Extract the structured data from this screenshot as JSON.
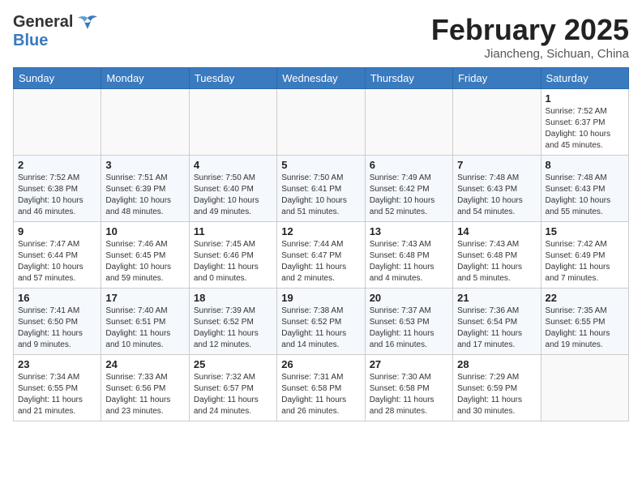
{
  "header": {
    "logo_general": "General",
    "logo_blue": "Blue",
    "month_title": "February 2025",
    "subtitle": "Jiancheng, Sichuan, China"
  },
  "days_of_week": [
    "Sunday",
    "Monday",
    "Tuesday",
    "Wednesday",
    "Thursday",
    "Friday",
    "Saturday"
  ],
  "weeks": [
    [
      {
        "day": "",
        "info": ""
      },
      {
        "day": "",
        "info": ""
      },
      {
        "day": "",
        "info": ""
      },
      {
        "day": "",
        "info": ""
      },
      {
        "day": "",
        "info": ""
      },
      {
        "day": "",
        "info": ""
      },
      {
        "day": "1",
        "info": "Sunrise: 7:52 AM\nSunset: 6:37 PM\nDaylight: 10 hours and 45 minutes."
      }
    ],
    [
      {
        "day": "2",
        "info": "Sunrise: 7:52 AM\nSunset: 6:38 PM\nDaylight: 10 hours and 46 minutes."
      },
      {
        "day": "3",
        "info": "Sunrise: 7:51 AM\nSunset: 6:39 PM\nDaylight: 10 hours and 48 minutes."
      },
      {
        "day": "4",
        "info": "Sunrise: 7:50 AM\nSunset: 6:40 PM\nDaylight: 10 hours and 49 minutes."
      },
      {
        "day": "5",
        "info": "Sunrise: 7:50 AM\nSunset: 6:41 PM\nDaylight: 10 hours and 51 minutes."
      },
      {
        "day": "6",
        "info": "Sunrise: 7:49 AM\nSunset: 6:42 PM\nDaylight: 10 hours and 52 minutes."
      },
      {
        "day": "7",
        "info": "Sunrise: 7:48 AM\nSunset: 6:43 PM\nDaylight: 10 hours and 54 minutes."
      },
      {
        "day": "8",
        "info": "Sunrise: 7:48 AM\nSunset: 6:43 PM\nDaylight: 10 hours and 55 minutes."
      }
    ],
    [
      {
        "day": "9",
        "info": "Sunrise: 7:47 AM\nSunset: 6:44 PM\nDaylight: 10 hours and 57 minutes."
      },
      {
        "day": "10",
        "info": "Sunrise: 7:46 AM\nSunset: 6:45 PM\nDaylight: 10 hours and 59 minutes."
      },
      {
        "day": "11",
        "info": "Sunrise: 7:45 AM\nSunset: 6:46 PM\nDaylight: 11 hours and 0 minutes."
      },
      {
        "day": "12",
        "info": "Sunrise: 7:44 AM\nSunset: 6:47 PM\nDaylight: 11 hours and 2 minutes."
      },
      {
        "day": "13",
        "info": "Sunrise: 7:43 AM\nSunset: 6:48 PM\nDaylight: 11 hours and 4 minutes."
      },
      {
        "day": "14",
        "info": "Sunrise: 7:43 AM\nSunset: 6:48 PM\nDaylight: 11 hours and 5 minutes."
      },
      {
        "day": "15",
        "info": "Sunrise: 7:42 AM\nSunset: 6:49 PM\nDaylight: 11 hours and 7 minutes."
      }
    ],
    [
      {
        "day": "16",
        "info": "Sunrise: 7:41 AM\nSunset: 6:50 PM\nDaylight: 11 hours and 9 minutes."
      },
      {
        "day": "17",
        "info": "Sunrise: 7:40 AM\nSunset: 6:51 PM\nDaylight: 11 hours and 10 minutes."
      },
      {
        "day": "18",
        "info": "Sunrise: 7:39 AM\nSunset: 6:52 PM\nDaylight: 11 hours and 12 minutes."
      },
      {
        "day": "19",
        "info": "Sunrise: 7:38 AM\nSunset: 6:52 PM\nDaylight: 11 hours and 14 minutes."
      },
      {
        "day": "20",
        "info": "Sunrise: 7:37 AM\nSunset: 6:53 PM\nDaylight: 11 hours and 16 minutes."
      },
      {
        "day": "21",
        "info": "Sunrise: 7:36 AM\nSunset: 6:54 PM\nDaylight: 11 hours and 17 minutes."
      },
      {
        "day": "22",
        "info": "Sunrise: 7:35 AM\nSunset: 6:55 PM\nDaylight: 11 hours and 19 minutes."
      }
    ],
    [
      {
        "day": "23",
        "info": "Sunrise: 7:34 AM\nSunset: 6:55 PM\nDaylight: 11 hours and 21 minutes."
      },
      {
        "day": "24",
        "info": "Sunrise: 7:33 AM\nSunset: 6:56 PM\nDaylight: 11 hours and 23 minutes."
      },
      {
        "day": "25",
        "info": "Sunrise: 7:32 AM\nSunset: 6:57 PM\nDaylight: 11 hours and 24 minutes."
      },
      {
        "day": "26",
        "info": "Sunrise: 7:31 AM\nSunset: 6:58 PM\nDaylight: 11 hours and 26 minutes."
      },
      {
        "day": "27",
        "info": "Sunrise: 7:30 AM\nSunset: 6:58 PM\nDaylight: 11 hours and 28 minutes."
      },
      {
        "day": "28",
        "info": "Sunrise: 7:29 AM\nSunset: 6:59 PM\nDaylight: 11 hours and 30 minutes."
      },
      {
        "day": "",
        "info": ""
      }
    ]
  ]
}
